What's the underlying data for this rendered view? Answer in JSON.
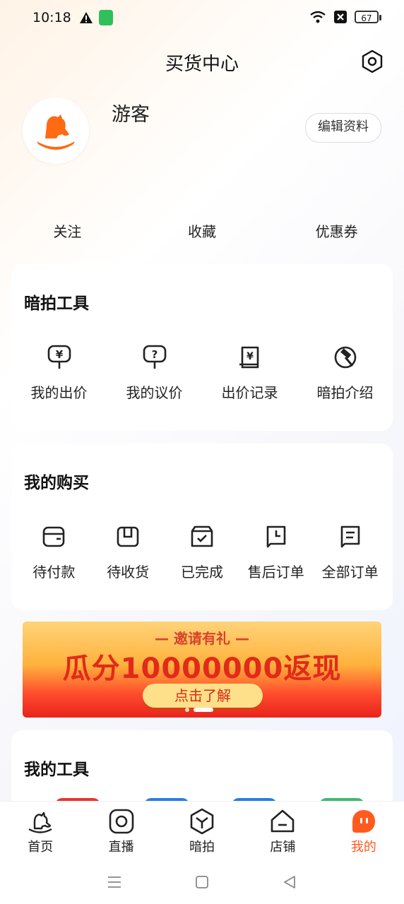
{
  "status": {
    "time": "10:18",
    "battery": "67"
  },
  "header": {
    "title": "买货中心"
  },
  "profile": {
    "username": "游客",
    "edit_label": "编辑资料"
  },
  "quick_links": [
    {
      "label": "关注"
    },
    {
      "label": "收藏"
    },
    {
      "label": "优惠券"
    }
  ],
  "auction_tools": {
    "title": "暗拍工具",
    "items": [
      {
        "label": "我的出价"
      },
      {
        "label": "我的议价"
      },
      {
        "label": "出价记录"
      },
      {
        "label": "暗拍介绍"
      }
    ]
  },
  "purchases": {
    "title": "我的购买",
    "items": [
      {
        "label": "待付款"
      },
      {
        "label": "待收货"
      },
      {
        "label": "已完成"
      },
      {
        "label": "售后订单"
      },
      {
        "label": "全部订单"
      }
    ]
  },
  "banner": {
    "top": "— 邀请有礼 —",
    "main": "瓜分10000000返现",
    "button": "点击了解"
  },
  "my_tools": {
    "title": "我的工具"
  },
  "tabbar": [
    {
      "label": "首页"
    },
    {
      "label": "直播"
    },
    {
      "label": "暗拍"
    },
    {
      "label": "店铺"
    },
    {
      "label": "我的"
    }
  ],
  "colors": {
    "accent": "#ff5a1f",
    "text": "#222222"
  }
}
